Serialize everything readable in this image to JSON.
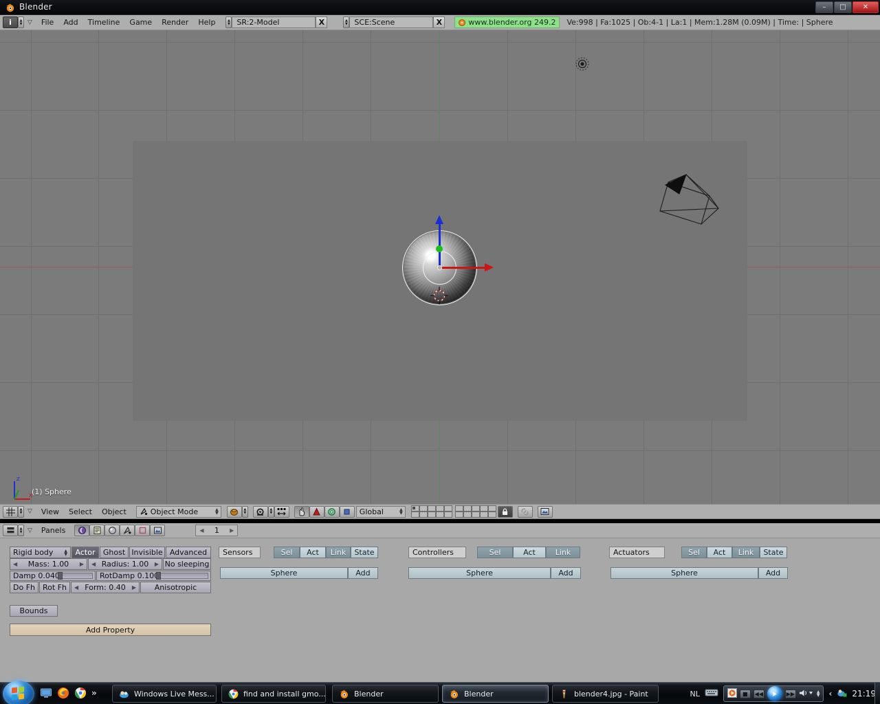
{
  "window": {
    "title": "Blender",
    "icon": "blender-logo-icon",
    "minimize_label": "–",
    "maximize_label": "□",
    "close_label": "✕"
  },
  "top_header": {
    "window_type_icon": "info-icon",
    "menu_collapse_icon": "menu-collapse-triangle-icon",
    "menus": [
      "File",
      "Add",
      "Timeline",
      "Game",
      "Render",
      "Help"
    ],
    "screen_selector": {
      "icon": "browse-screen-icon",
      "value": "SR:2-Model",
      "delete_label": "X"
    },
    "scene_selector": {
      "icon": "browse-scene-icon",
      "value": "SCE:Scene",
      "delete_label": "X"
    },
    "version_badge": {
      "icon": "blender-dot-icon",
      "text": "www.blender.org 249.2"
    },
    "stats": "Ve:998 | Fa:1025 | Ob:4-1 | La:1  | Mem:1.28M (0.09M)  | Time: | Sphere"
  },
  "viewport": {
    "object_label": "(1) Sphere",
    "axis_gizmo": {
      "z_label": "z",
      "x_label": "x"
    },
    "objects": [
      {
        "name": "sphere",
        "type": "mesh",
        "selected": true
      },
      {
        "name": "camera",
        "type": "camera",
        "selected": false
      },
      {
        "name": "lamp",
        "type": "lamp",
        "selected": false
      },
      {
        "name": "plane",
        "type": "mesh",
        "selected": false
      }
    ],
    "manipulator": {
      "mode": "translate",
      "z_axis_color": "#1a2ed6",
      "x_axis_color": "#cf1414",
      "y_axis_color": "#18c018"
    },
    "colors": {
      "background": "#7b7b7b",
      "grid": "#6f6f6f",
      "x_axis": "#9a5b5b",
      "y_axis": "#5b8a5b",
      "plane": "#757575"
    }
  },
  "viewport_header": {
    "window_type_icon": "3d-view-icon",
    "menu_collapse_icon": "menu-collapse-triangle-icon",
    "menus": [
      "View",
      "Select",
      "Object"
    ],
    "mode": {
      "icon": "object-mode-icon",
      "value": "Object Mode"
    },
    "draw_type_icon": "solid-shading-icon",
    "pivot_icon": "pivot-median-point-icon",
    "snap_icon": "snap-icon",
    "manipulator_toggle_icon": "manipulator-hand-icon",
    "rotate_manip_icon": "rotate-manipulator-icon",
    "scale_manip_icon": "scale-manipulator-icon",
    "extra_manip_icon": "translate-manipulator-icon",
    "orientation": {
      "value": "Global"
    },
    "layers_lock_icon": "lock-icon",
    "render_link_icon": "link-render-icon",
    "render_window_icon": "render-preview-icon",
    "layers": {
      "group1": [
        true,
        false,
        false,
        false,
        false,
        false,
        false,
        false,
        false,
        false
      ],
      "group2": [
        false,
        false,
        false,
        false,
        false,
        false,
        false,
        false,
        false,
        false
      ]
    }
  },
  "buttons_header": {
    "window_type_icon": "buttons-window-icon",
    "menu_collapse_icon": "menu-collapse-triangle-icon",
    "menu_label": "Panels",
    "context_icons": [
      "logic-context-icon",
      "script-context-icon",
      "shading-context-icon",
      "object-context-icon",
      "editing-context-icon",
      "scene-context-icon"
    ],
    "frame_field": {
      "value": "1",
      "prev_icon": "chevron-left-icon",
      "next_icon": "chevron-right-icon"
    }
  },
  "logic_panel": {
    "physics": {
      "type_selector": "Rigid body",
      "toggles": [
        {
          "label": "Actor",
          "active": true
        },
        {
          "label": "Ghost",
          "active": false
        },
        {
          "label": "Invisible",
          "active": false
        },
        {
          "label": "Advanced",
          "active": false
        }
      ],
      "mass": "Mass: 1.00",
      "radius": "Radius: 1.00",
      "no_sleeping": "No sleeping",
      "damp": {
        "label": "Damp 0.040",
        "value": 0.04
      },
      "rotdamp": {
        "label": "RotDamp 0.100",
        "value": 0.1
      },
      "do_fh": "Do Fh",
      "rot_fh": "Rot Fh",
      "form": "Form: 0.40",
      "anisotropic": "Anisotropic",
      "bounds": "Bounds",
      "add_property": "Add Property"
    },
    "sensors": {
      "title": "Sensors",
      "filters": [
        {
          "label": "Sel",
          "active": true
        },
        {
          "label": "Act",
          "active": false
        },
        {
          "label": "Link",
          "active": true
        },
        {
          "label": "State",
          "active": false
        }
      ],
      "object_row": "Sphere",
      "add_label": "Add"
    },
    "controllers": {
      "title": "Controllers",
      "filters": [
        {
          "label": "Sel",
          "active": true
        },
        {
          "label": "Act",
          "active": false
        },
        {
          "label": "Link",
          "active": true
        }
      ],
      "object_row": "Sphere",
      "add_label": "Add"
    },
    "actuators": {
      "title": "Actuators",
      "filters": [
        {
          "label": "Sel",
          "active": true
        },
        {
          "label": "Act",
          "active": false
        },
        {
          "label": "Link",
          "active": true
        },
        {
          "label": "State",
          "active": false
        }
      ],
      "object_row": "Sphere",
      "add_label": "Add"
    }
  },
  "taskbar": {
    "start_icon": "windows-start-orb-icon",
    "quick_launch": [
      {
        "name": "show-desktop-icon"
      },
      {
        "name": "firefox-icon"
      },
      {
        "name": "chrome-icon"
      }
    ],
    "quick_launch_overflow": "»",
    "tasks": [
      {
        "label": "Windows Live Mess...",
        "icon": "messenger-icon",
        "active": false
      },
      {
        "label": "find and install gmo...",
        "icon": "chrome-icon",
        "active": false
      },
      {
        "label": "Blender",
        "icon": "blender-logo-icon",
        "active": false
      },
      {
        "label": "Blender",
        "icon": "blender-logo-icon",
        "active": true
      },
      {
        "label": "blender4.jpg - Paint",
        "icon": "paint-icon",
        "active": false
      }
    ],
    "tray": {
      "language": "NL",
      "keyboard_icon": "keyboard-icon",
      "media_player": {
        "app_icon": "wmp-icon",
        "stop_icon": "stop-icon",
        "prev_icon": "previous-icon",
        "play_icon": "play-icon",
        "next_icon": "next-icon",
        "volume_icon": "volume-icon"
      },
      "overflow_icon": "show-hidden-icons-icon",
      "messenger_icon": "messenger-tray-icon",
      "clock": "21:19"
    }
  }
}
